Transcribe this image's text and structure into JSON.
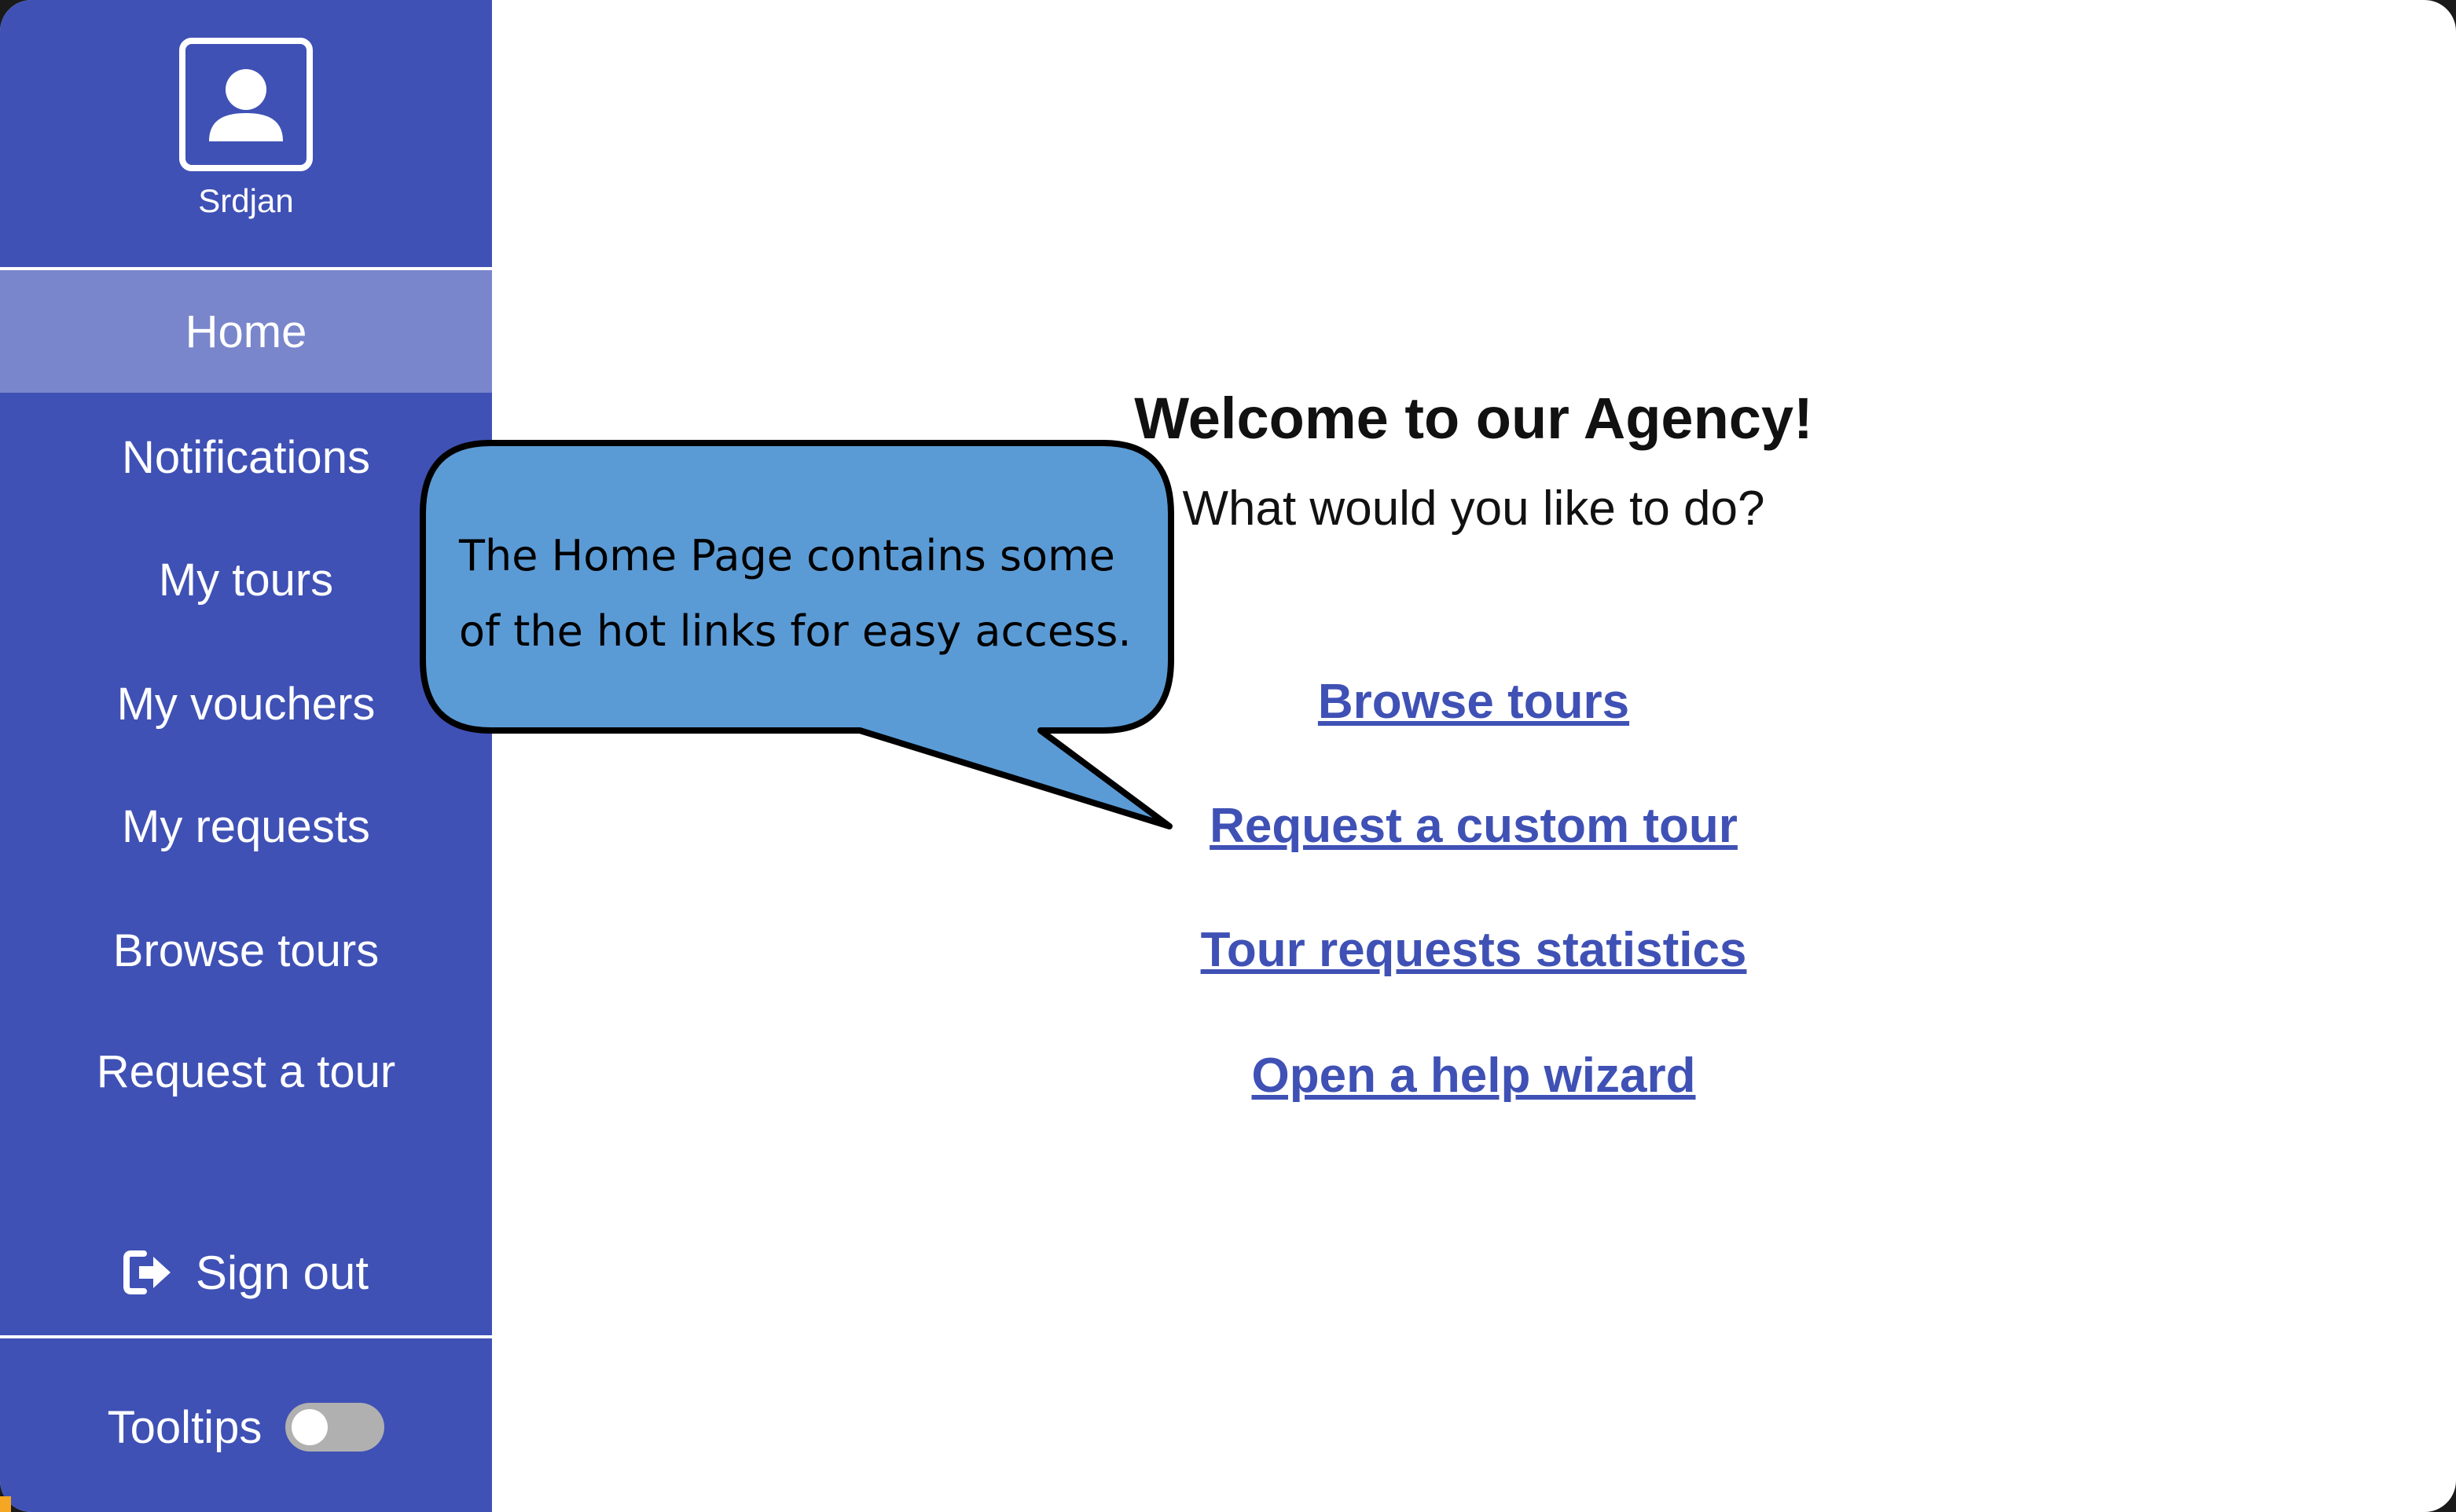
{
  "user": {
    "name": "Srdjan"
  },
  "sidebar": {
    "items": [
      {
        "label": "Home",
        "active": true
      },
      {
        "label": "Notifications"
      },
      {
        "label": "My tours"
      },
      {
        "label": "My vouchers"
      },
      {
        "label": "My requests"
      },
      {
        "label": "Browse tours"
      },
      {
        "label": "Request a tour"
      }
    ],
    "signout_label": "Sign out",
    "tooltips_label": "Tooltips",
    "tooltips_enabled": false
  },
  "main": {
    "title": "Welcome to our Agency!",
    "subtitle": "What would you like to do?",
    "links": [
      "Browse tours",
      "Request a custom tour",
      "Tour requests statistics",
      "Open a help wizard"
    ]
  },
  "callout": {
    "line1": "The Home Page contains some",
    "line2": "of the hot links for easy access."
  },
  "colors": {
    "sidebar": "#3f51b5",
    "active_item": "#7986cb",
    "link": "#3f51b5",
    "callout_fill": "#5b9bd5"
  }
}
